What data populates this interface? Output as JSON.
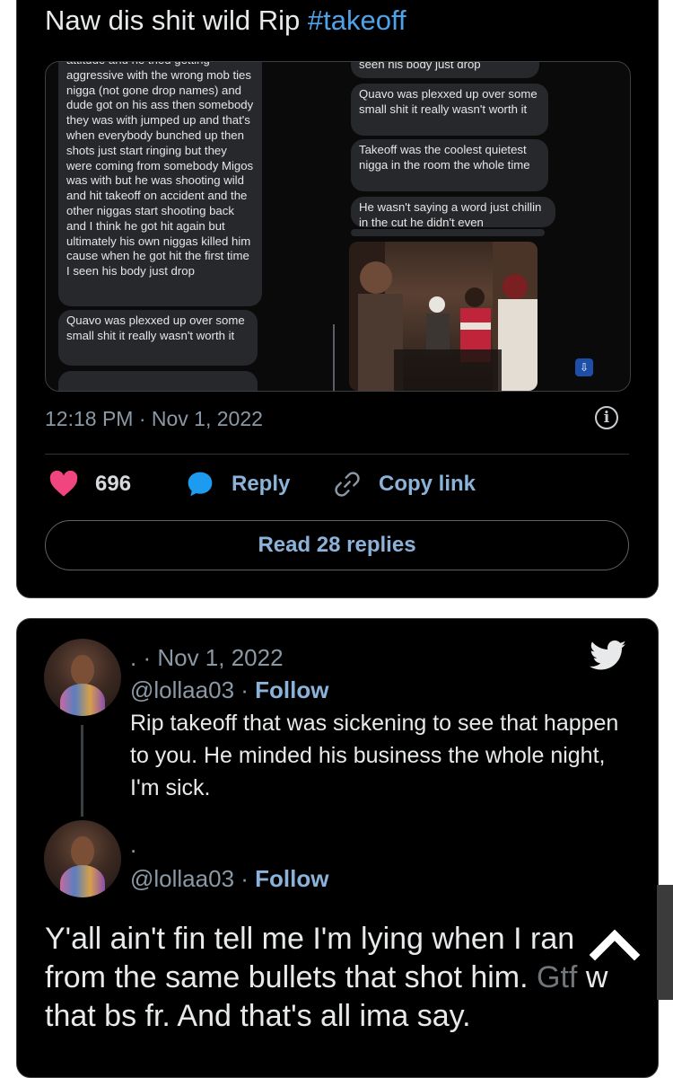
{
  "tweet": {
    "text_prefix": "Naw dis shit wild Rip ",
    "hashtag": "#takeoff",
    "timestamp": "12:18 PM · Nov 1, 2022",
    "likes": "696",
    "reply_label": "Reply",
    "copy_label": "Copy link",
    "read_replies": "Read 28 replies"
  },
  "media": {
    "left_bubbles": [
      "attitude and he tried getting aggressive with the wrong mob ties nigga (not gone drop names) and dude got on his ass then somebody they was with jumped up and that's when everybody bunched up then shots just start ringing but they were coming from somebody Migos was with but he was shooting wild and hit takeoff on accident and the other niggas start shooting back and I think he got hit again but ultimately his own niggas killed him cause when he got hit the first time I seen his body just drop",
      "Quavo was plexxed up over some small shit it really wasn't worth it"
    ],
    "right_bubbles": [
      "seen his body just drop",
      "Quavo was plexxed up over some small shit it really wasn't worth it",
      "Takeoff was the coolest quietest nigga in the room the whole time",
      "He wasn't saying a word just chillin in the cut he didn't even"
    ]
  },
  "reply1": {
    "name": ".",
    "date": "· Nov 1, 2022",
    "handle": "@lollaa03",
    "sep": " · ",
    "follow": "Follow",
    "text": "Rip takeoff that was sickening to see that happen to you. He minded his business the whole night, I'm sick."
  },
  "reply2": {
    "name": ".",
    "handle": "@lollaa03",
    "sep": " · ",
    "follow": "Follow",
    "text_main": "Y'all ain't fin tell me I'm lying when I ran from the same bullets that shot him. ",
    "text_faded": "Gtf",
    "text_end": " w that bs fr. And that's all ima say."
  },
  "colors": {
    "background": "#000000",
    "accent": "#8bb3d9",
    "hashtag": "#4ea3e8",
    "heart": "#f0457f",
    "muted": "#8b98a5"
  },
  "icons": {
    "like": "heart-icon",
    "reply": "speech-bubble-icon",
    "copy": "link-icon",
    "info": "info-icon",
    "brand": "twitter-bird-icon",
    "scroll": "chevron-up-icon"
  }
}
